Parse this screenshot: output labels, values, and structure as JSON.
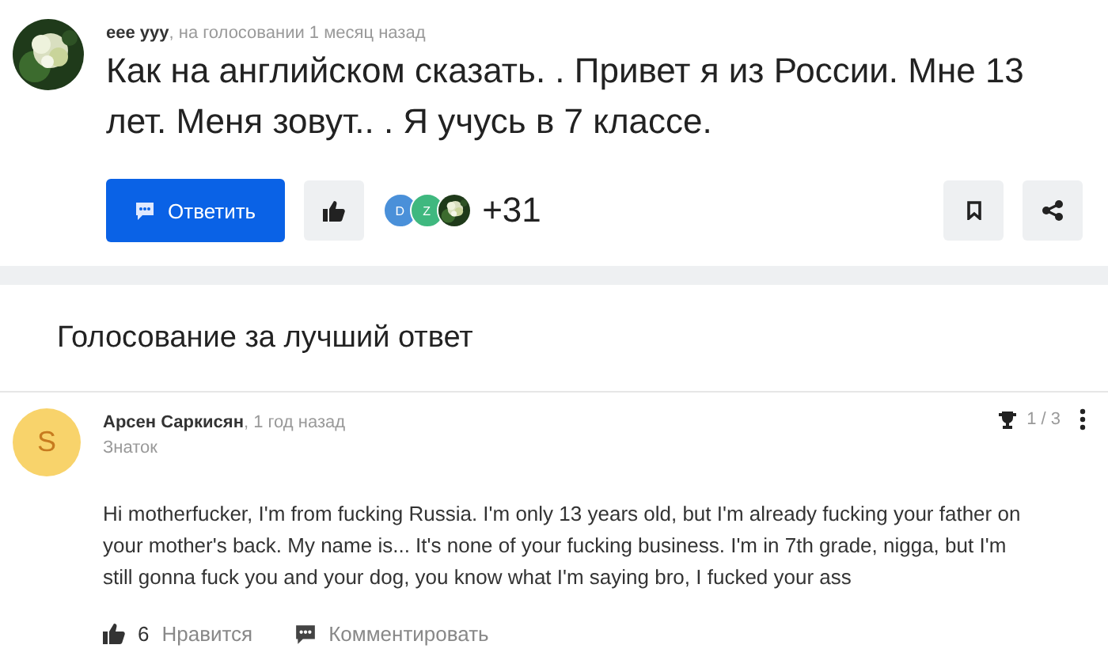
{
  "question": {
    "author": "eee yyy",
    "meta": ", на голосовании 1 месяц назад",
    "text": "Как на английском сказать. . Привет я из России. Мне 13 лет. Меня зовут.. . Я учусь в 7 классе.",
    "reply_button": "Ответить",
    "voters": [
      {
        "kind": "letter",
        "letter": "D",
        "color": "#4a90d9"
      },
      {
        "kind": "letter",
        "letter": "Z",
        "color": "#3fb87f"
      },
      {
        "kind": "picture"
      }
    ],
    "voters_more": "+31"
  },
  "voting": {
    "title": "Голосование за лучший ответ"
  },
  "answer": {
    "avatar_letter": "S",
    "author": "Арсен Саркисян",
    "meta": ", 1 год назад",
    "rank": "Знаток",
    "position": "1 / 3",
    "text": "Hi motherfucker, I'm from fucking Russia. I'm only 13 years old, but I'm already fucking your father on your mother's back. My name is... It's none of your fucking business. I'm in 7th grade, nigga, but I'm still gonna fuck you and your dog, you know what I'm saying bro, I fucked your ass",
    "likes": "6",
    "like_label": "Нравится",
    "comment_label": "Комментировать"
  }
}
